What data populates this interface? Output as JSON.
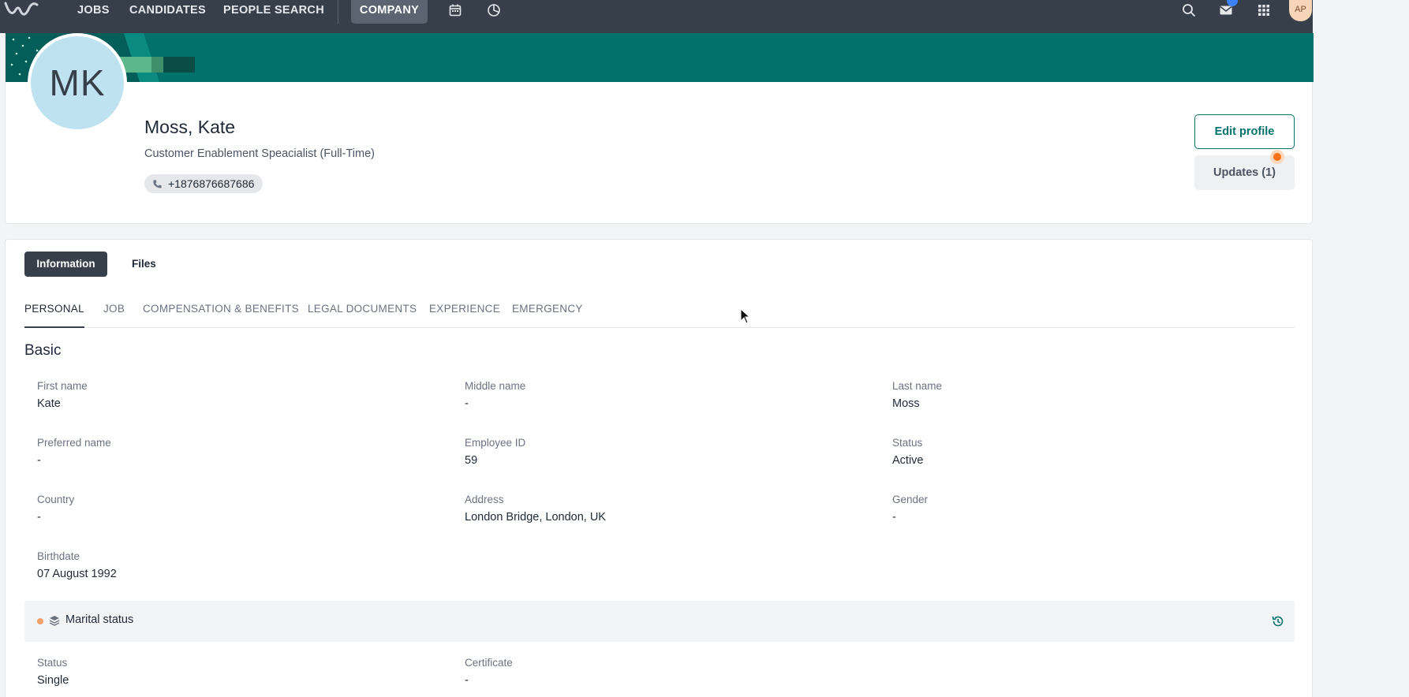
{
  "nav": {
    "items": [
      {
        "label": "JOBS"
      },
      {
        "label": "CANDIDATES"
      },
      {
        "label": "PEOPLE SEARCH"
      }
    ],
    "active": "COMPANY",
    "user_initials": "AP",
    "icons": [
      "calendar-icon",
      "pie-chart-icon",
      "search-icon",
      "mail-icon",
      "apps-grid-icon"
    ]
  },
  "profile": {
    "initials": "MK",
    "name": "Moss, Kate",
    "role": "Customer Enablement Speacialist (Full-Time)",
    "phone": "+1876876687686",
    "edit_label": "Edit profile",
    "updates_label": "Updates (1)"
  },
  "tabs": {
    "main": [
      "Information",
      "Files"
    ],
    "sub": [
      "PERSONAL",
      "JOB",
      "COMPENSATION & BENEFITS",
      "LEGAL DOCUMENTS",
      "EXPERIENCE",
      "EMERGENCY"
    ]
  },
  "basic": {
    "title": "Basic",
    "fields": [
      {
        "label": "First name",
        "value": "Kate"
      },
      {
        "label": "Middle name",
        "value": "-"
      },
      {
        "label": "Last name",
        "value": "Moss"
      },
      {
        "label": "Preferred name",
        "value": "-"
      },
      {
        "label": "Employee ID",
        "value": "59"
      },
      {
        "label": "Status",
        "value": "Active"
      },
      {
        "label": "Country",
        "value": "-"
      },
      {
        "label": "Address",
        "value": "London Bridge, London, UK"
      },
      {
        "label": "Gender",
        "value": "-"
      },
      {
        "label": "Birthdate",
        "value": "07 August 1992"
      }
    ]
  },
  "marital": {
    "title": "Marital status",
    "fields": [
      {
        "label": "Status",
        "value": "Single"
      },
      {
        "label": "Certificate",
        "value": "-"
      }
    ]
  },
  "colors": {
    "brand": "#01716b",
    "nav": "#37404a",
    "accent_orange": "#f97316"
  }
}
